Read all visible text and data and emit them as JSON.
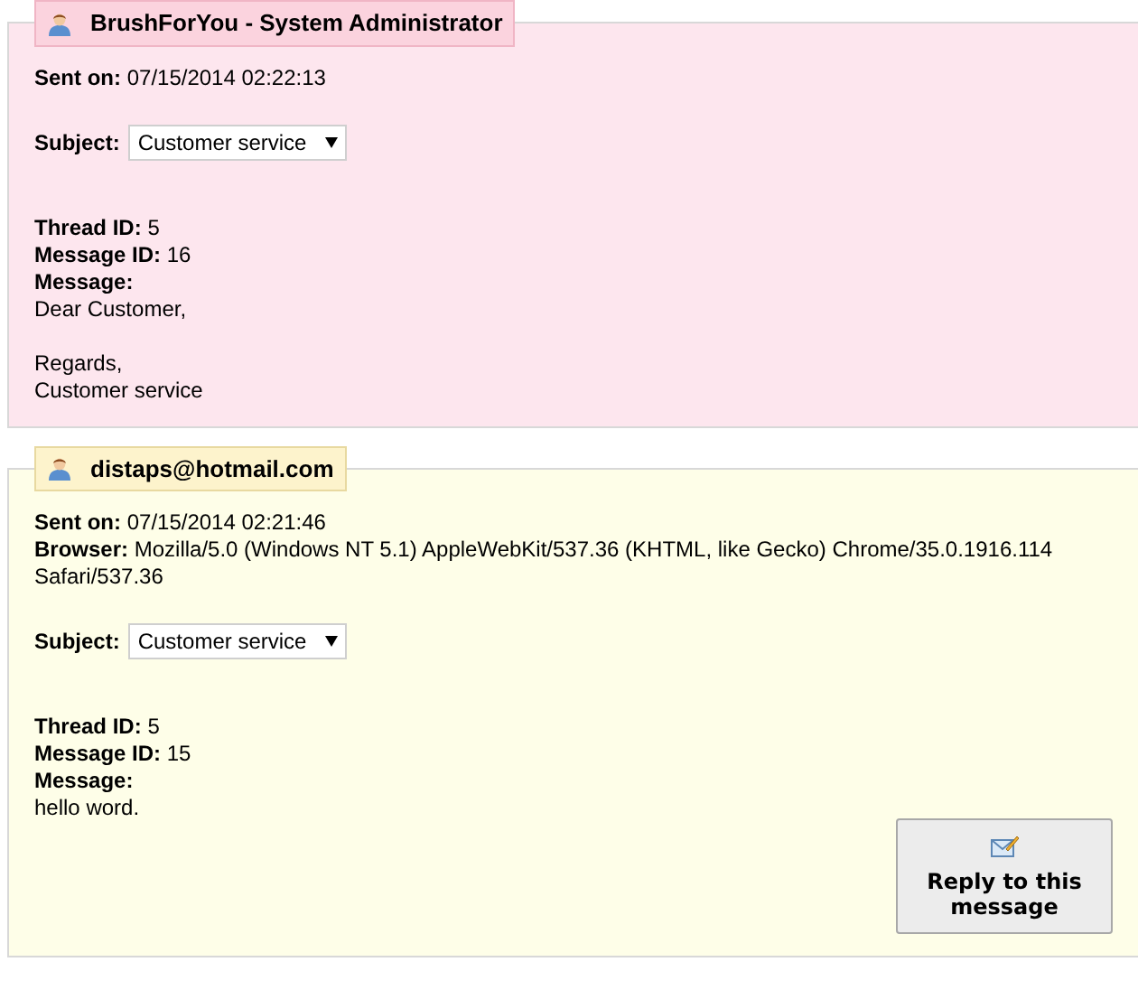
{
  "messages": [
    {
      "kind": "staff",
      "sender": "BrushForYou - System Administrator",
      "header_fields": [
        {
          "label": "Sent on:",
          "value": "07/15/2014 02:22:13"
        }
      ],
      "subject_label": "Subject:",
      "subject": "Customer service",
      "id_fields": [
        {
          "label": "Thread ID:",
          "value": "5"
        },
        {
          "label": "Message ID:",
          "value": "16"
        }
      ],
      "message_label": "Message:",
      "message_paragraphs": [
        "Dear Customer,",
        "Regards,\nCustomer service"
      ]
    },
    {
      "kind": "customer",
      "sender": "distaps@hotmail.com",
      "header_fields": [
        {
          "label": "Sent on:",
          "value": "07/15/2014 02:21:46"
        },
        {
          "label": "Browser:",
          "value": "Mozilla/5.0 (Windows NT 5.1) AppleWebKit/537.36 (KHTML, like Gecko) Chrome/35.0.1916.114",
          "value_continued": "Safari/537.36"
        }
      ],
      "subject_label": "Subject:",
      "subject": "Customer service",
      "id_fields": [
        {
          "label": "Thread ID:",
          "value": "5"
        },
        {
          "label": "Message ID:",
          "value": "15"
        }
      ],
      "message_label": "Message:",
      "message_paragraphs": [
        "hello word."
      ],
      "reply_button": "Reply to this message"
    }
  ]
}
